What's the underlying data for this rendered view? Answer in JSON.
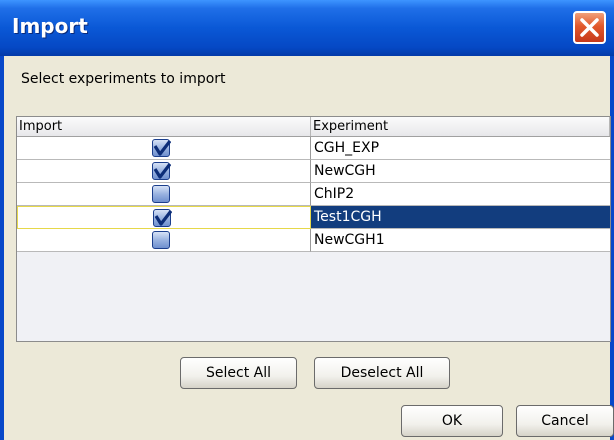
{
  "window": {
    "title": "Import",
    "close_icon": "close-icon",
    "title_bar_color": "#0a58d6",
    "close_button_color": "#e2592c"
  },
  "instruction": "Select experiments to import",
  "table": {
    "columns": [
      "Import",
      "Experiment"
    ],
    "rows": [
      {
        "checked": true,
        "experiment": "CGH_EXP",
        "selected": false
      },
      {
        "checked": true,
        "experiment": "NewCGH",
        "selected": false
      },
      {
        "checked": false,
        "experiment": "ChIP2",
        "selected": false
      },
      {
        "checked": true,
        "experiment": "Test1CGH",
        "selected": true
      },
      {
        "checked": false,
        "experiment": "NewCGH1",
        "selected": false
      }
    ],
    "selection_color": "#123d7e"
  },
  "buttons": {
    "select_all": "Select All",
    "deselect_all": "Deselect All",
    "ok": "OK",
    "cancel": "Cancel"
  }
}
